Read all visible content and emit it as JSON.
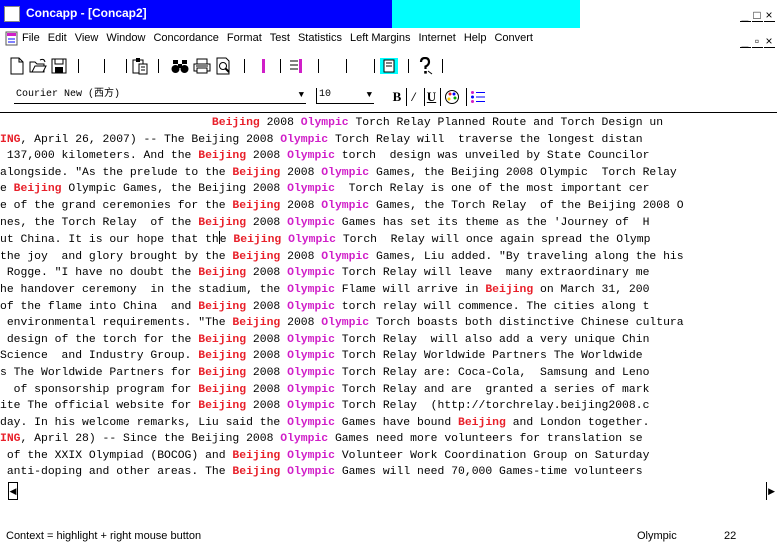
{
  "window": {
    "title": "Concapp - [Concap2]",
    "controls": [
      "_",
      "□",
      "×"
    ]
  },
  "menu": {
    "items": [
      "File",
      "Edit",
      "View",
      "Window",
      "Concordance",
      "Format",
      "Test",
      "Statistics",
      "Left Margins",
      "Internet",
      "Help",
      "Convert"
    ],
    "doc_controls": [
      "_",
      "▫",
      "×"
    ]
  },
  "format": {
    "font_name": "Courier New (西方)",
    "font_size": "10",
    "bold": "B",
    "italic": "/",
    "underline": "U"
  },
  "colors": {
    "title_bar": "#0000ff",
    "title_highlight": "#00ffff",
    "keyword_beijing": "#e8202a",
    "keyword_olympic": "#d01ec8"
  },
  "concordance_lines": [
    [
      [
        "t",
        "                               "
      ],
      [
        "b",
        "Beijing"
      ],
      [
        "t",
        " 2008 "
      ],
      [
        "o",
        "Olympic"
      ],
      [
        "t",
        " Torch Relay Planned Route and Torch Design un"
      ]
    ],
    [
      [
        "b",
        "ING"
      ],
      [
        "t",
        ", April 26, 2007) -- The Beijing 2008 "
      ],
      [
        "o",
        "Olympic"
      ],
      [
        "t",
        " Torch Relay will  traverse the longest distan"
      ]
    ],
    [
      [
        "t",
        " 137,000 kilometers. And the "
      ],
      [
        "b",
        "Beijing"
      ],
      [
        "t",
        " 2008 "
      ],
      [
        "o",
        "Olympic"
      ],
      [
        "t",
        " torch  design was unveiled by State Councilor"
      ]
    ],
    [
      [
        "t",
        "alongside. \"As the prelude to the "
      ],
      [
        "b",
        "Beijing"
      ],
      [
        "t",
        " 2008 "
      ],
      [
        "o",
        "Olympic"
      ],
      [
        "t",
        " Games, the Beijing 2008 Olympic  Torch Relay"
      ]
    ],
    [
      [
        "t",
        "e "
      ],
      [
        "b",
        "Beijing"
      ],
      [
        "t",
        " Olympic Games, the Beijing 2008 "
      ],
      [
        "o",
        "Olympic"
      ],
      [
        "t",
        "  Torch Relay is one of the most important cer"
      ]
    ],
    [
      [
        "t",
        "e of the grand ceremonies for the "
      ],
      [
        "b",
        "Beijing"
      ],
      [
        "t",
        " 2008 "
      ],
      [
        "o",
        "Olympic"
      ],
      [
        "t",
        " Games, the Torch Relay  of the Beijing 2008 O"
      ]
    ],
    [
      [
        "t",
        "nes, the Torch Relay  of the "
      ],
      [
        "b",
        "Beijing"
      ],
      [
        "t",
        " 2008 "
      ],
      [
        "o",
        "Olympic"
      ],
      [
        "t",
        " Games has set its theme as the 'Journey of  H"
      ]
    ],
    [
      [
        "t",
        "ut China. It is our hope that th"
      ],
      [
        "c",
        ""
      ],
      [
        "t",
        "e "
      ],
      [
        "b",
        "Beijing"
      ],
      [
        "t",
        " "
      ],
      [
        "o",
        "Olympic"
      ],
      [
        "t",
        " Torch  Relay will once again spread the Olymp"
      ]
    ],
    [
      [
        "t",
        "the joy  and glory brought by the "
      ],
      [
        "b",
        "Beijing"
      ],
      [
        "t",
        " 2008 "
      ],
      [
        "o",
        "Olympic"
      ],
      [
        "t",
        " Games, Liu added. \"By traveling along the his"
      ]
    ],
    [
      [
        "t",
        " Rogge. \"I have no doubt the "
      ],
      [
        "b",
        "Beijing"
      ],
      [
        "t",
        " 2008 "
      ],
      [
        "o",
        "Olympic"
      ],
      [
        "t",
        " Torch Relay will leave  many extraordinary me"
      ]
    ],
    [
      [
        "t",
        "he handover ceremony  in the stadium, the "
      ],
      [
        "o",
        "Olympic"
      ],
      [
        "t",
        " Flame will arrive in "
      ],
      [
        "b",
        "Beijing"
      ],
      [
        "t",
        " on March 31, 200"
      ]
    ],
    [
      [
        "t",
        "of the flame into China  and "
      ],
      [
        "b",
        "Beijing"
      ],
      [
        "t",
        " 2008 "
      ],
      [
        "o",
        "Olympic"
      ],
      [
        "t",
        " torch relay will commence. The cities along t"
      ]
    ],
    [
      [
        "t",
        " environmental requirements. \"The "
      ],
      [
        "b",
        "Beijing"
      ],
      [
        "t",
        " 2008 "
      ],
      [
        "o",
        "Olympic"
      ],
      [
        "t",
        " Torch boasts both distinctive Chinese cultura"
      ]
    ],
    [
      [
        "t",
        " design of the torch for the "
      ],
      [
        "b",
        "Beijing"
      ],
      [
        "t",
        " 2008 "
      ],
      [
        "o",
        "Olympic"
      ],
      [
        "t",
        " Torch Relay  will also add a very unique Chin"
      ]
    ],
    [
      [
        "t",
        "Science  and Industry Group. "
      ],
      [
        "b",
        "Beijing"
      ],
      [
        "t",
        " 2008 "
      ],
      [
        "o",
        "Olympic"
      ],
      [
        "t",
        " Torch Relay Worldwide Partners The Worldwide"
      ]
    ],
    [
      [
        "t",
        "s The Worldwide Partners for "
      ],
      [
        "b",
        "Beijing"
      ],
      [
        "t",
        " 2008 "
      ],
      [
        "o",
        "Olympic"
      ],
      [
        "t",
        " Torch Relay are: Coca-Cola,  Samsung and Leno"
      ]
    ],
    [
      [
        "t",
        "  of sponsorship program for "
      ],
      [
        "b",
        "Beijing"
      ],
      [
        "t",
        " 2008 "
      ],
      [
        "o",
        "Olympic"
      ],
      [
        "t",
        " Torch Relay and are  granted a series of mark"
      ]
    ],
    [
      [
        "t",
        "ite The official website for "
      ],
      [
        "b",
        "Beijing"
      ],
      [
        "t",
        " 2008 "
      ],
      [
        "o",
        "Olympic"
      ],
      [
        "t",
        " Torch Relay  (http://torchrelay.beijing2008.c"
      ]
    ],
    [
      [
        "t",
        "day. In his welcome remarks, Liu said the "
      ],
      [
        "o",
        "Olympic"
      ],
      [
        "t",
        " Games have bound "
      ],
      [
        "b",
        "Beijing"
      ],
      [
        "t",
        " and London together."
      ]
    ],
    [
      [
        "b",
        "ING"
      ],
      [
        "t",
        ", April 28) -- Since the Beijing 2008 "
      ],
      [
        "o",
        "Olympic"
      ],
      [
        "t",
        " Games need more volunteers for translation se"
      ]
    ],
    [
      [
        "t",
        " of the XXIX Olympiad (BOCOG) and "
      ],
      [
        "b",
        "Beijing"
      ],
      [
        "t",
        " "
      ],
      [
        "o",
        "Olympic"
      ],
      [
        "t",
        " Volunteer Work Coordination Group on Saturday"
      ]
    ],
    [
      [
        "t",
        " anti-doping and other areas. The "
      ],
      [
        "b",
        "Beijing"
      ],
      [
        "t",
        " "
      ],
      [
        "o",
        "Olympic"
      ],
      [
        "t",
        " Games will need 70,000 Games-time volunteers"
      ]
    ]
  ],
  "status": {
    "message": "Context = highlight + right mouse button",
    "search_term": "Olympic",
    "hit_count": "22"
  }
}
